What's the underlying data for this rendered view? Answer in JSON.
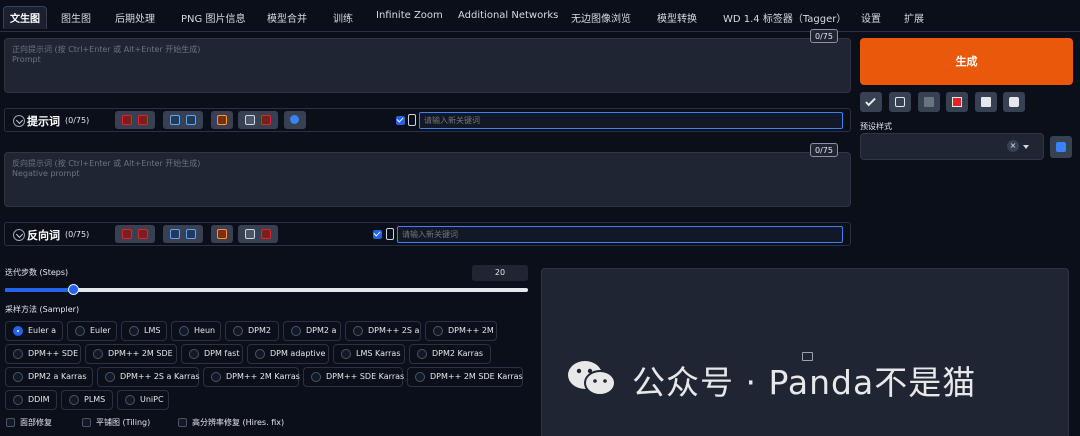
{
  "tabs": [
    {
      "label": "文生图",
      "active": true
    },
    {
      "label": "图生图"
    },
    {
      "label": "后期处理"
    },
    {
      "label": "PNG 图片信息"
    },
    {
      "label": "模型合并"
    },
    {
      "label": "训练"
    },
    {
      "label": "Infinite Zoom"
    },
    {
      "label": "Additional Networks"
    },
    {
      "label": "无边图像浏览"
    },
    {
      "label": "模型转换"
    },
    {
      "label": "WD 1.4 标签器（Tagger）"
    },
    {
      "label": "设置"
    },
    {
      "label": "扩展"
    }
  ],
  "positive": {
    "placeholder_line1": "正向提示词 (按 Ctrl+Enter 或 Alt+Enter 开始生成)",
    "placeholder_line2": "Prompt",
    "token_counter": "0/75",
    "toolbar_label": "提示词",
    "toolbar_count": "(0/75)",
    "search_placeholder": "请输入新关键词"
  },
  "negative": {
    "placeholder_line1": "反向提示词 (按 Ctrl+Enter 或 Alt+Enter 开始生成)",
    "placeholder_line2": "Negative prompt",
    "token_counter": "0/75",
    "toolbar_label": "反向词",
    "toolbar_count": "(0/75)",
    "search_placeholder": "请输入新关键词"
  },
  "generate_label": "生成",
  "styles": {
    "label": "预设样式",
    "clear": "×"
  },
  "steps": {
    "label": "迭代步数 (Steps)",
    "value": "20",
    "fraction": 0.13
  },
  "sampler": {
    "label": "采样方法 (Sampler)",
    "options": [
      "Euler a",
      "Euler",
      "LMS",
      "Heun",
      "DPM2",
      "DPM2 a",
      "DPM++ 2S a",
      "DPM++ 2M",
      "DPM++ SDE",
      "DPM++ 2M SDE",
      "DPM fast",
      "DPM adaptive",
      "LMS Karras",
      "DPM2 Karras",
      "DPM2 a Karras",
      "DPM++ 2S a Karras",
      "DPM++ 2M Karras",
      "DPM++ SDE Karras",
      "DPM++ 2M SDE Karras",
      "DDIM",
      "PLMS",
      "UniPC"
    ],
    "selected": "Euler a"
  },
  "options": {
    "restore_faces": "面部修复",
    "tiling": "平铺图 (Tiling)",
    "hires_fix": "高分辨率修复 (Hires. fix)"
  },
  "watermark": "公众号 · Panda不是猫",
  "colors": {
    "accent": "#ea580c",
    "primary": "#2563eb",
    "background": "#0b0f19",
    "panel": "#1f2533"
  }
}
